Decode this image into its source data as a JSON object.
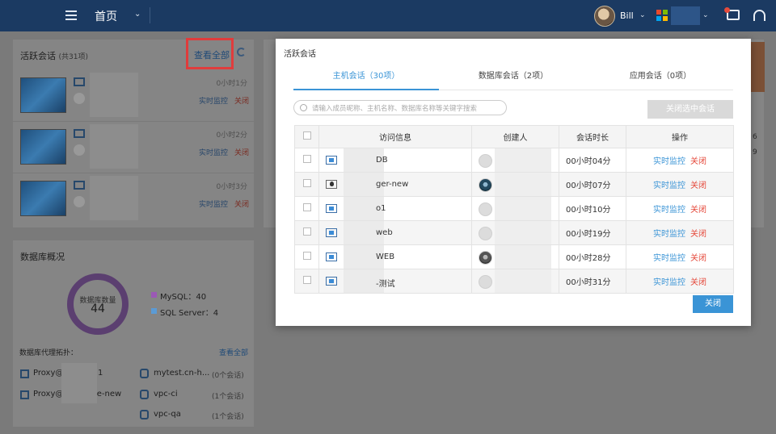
{
  "topbar": {
    "home_label": "首页",
    "user_name": "Bill",
    "colors": {
      "bar": "#1b3a62",
      "ms_red": "#e8492c",
      "ms_green": "#7fba00",
      "ms_blue": "#00a4ef",
      "ms_yellow": "#ffb900"
    }
  },
  "sessions_panel": {
    "title": "活跃会话",
    "count_text": "(共31项)",
    "view_all": "查看全部",
    "items": [
      {
        "duration": "0小时1分",
        "monitor": "实时监控",
        "close": "关闭"
      },
      {
        "duration": "0小时2分",
        "monitor": "实时监控",
        "close": "关闭"
      },
      {
        "duration": "0小时3分",
        "monitor": "实时监控",
        "close": "关闭"
      }
    ]
  },
  "db_panel": {
    "title": "数据库概况",
    "donut_label": "数据库数量",
    "donut_value": "44",
    "legend": [
      {
        "label": "MySQL：40",
        "color": "#9b59b6"
      },
      {
        "label": "SQL Server：4",
        "color": "#5b9bd5"
      }
    ],
    "proxy_title": "数据库代理拓扑：",
    "proxy_view_all": "查看全部",
    "proxies": [
      {
        "prefix": "Proxy@",
        "suffix": "1"
      },
      {
        "prefix": "Proxy@",
        "suffix": "je-new"
      }
    ],
    "nodes": [
      {
        "name": "mytest.cn-h...",
        "count": "(0个会话)"
      },
      {
        "name": "vpc-ci",
        "count": "(1个会话)"
      },
      {
        "name": "vpc-qa",
        "count": "(1个会话)"
      }
    ]
  },
  "right_panel": {
    "numbers": [
      "6",
      "9"
    ]
  },
  "modal": {
    "title": "活跃会话",
    "tabs": [
      {
        "label": "主机会话（30项）",
        "active": true
      },
      {
        "label": "数据库会话（2项）",
        "active": false
      },
      {
        "label": "应用会话（0项）",
        "active": false
      }
    ],
    "search_placeholder": "请输入成员昵称、主机名称、数据库名称等关键字搜索",
    "close_selected_label": "关闭选中会话",
    "table": {
      "headers": [
        "访问信息",
        "创建人",
        "会话时长",
        "操作"
      ],
      "rows": [
        {
          "os": "windows",
          "info": "DB",
          "avatar": "default",
          "duration": "00小时04分",
          "monitor": "实时监控",
          "close": "关闭"
        },
        {
          "os": "linux",
          "info": "ger-new",
          "avatar": "photo1",
          "duration": "00小时07分",
          "monitor": "实时监控",
          "close": "关闭"
        },
        {
          "os": "windows",
          "info": "o1",
          "avatar": "default",
          "duration": "00小时10分",
          "monitor": "实时监控",
          "close": "关闭"
        },
        {
          "os": "windows",
          "info": "web",
          "avatar": "default",
          "duration": "00小时19分",
          "monitor": "实时监控",
          "close": "关闭"
        },
        {
          "os": "windows",
          "info": "WEB",
          "avatar": "photo2",
          "duration": "00小时28分",
          "monitor": "实时监控",
          "close": "关闭"
        },
        {
          "os": "windows",
          "info": "-测试",
          "avatar": "default",
          "duration": "00小时31分",
          "monitor": "实时监控",
          "close": "关闭"
        }
      ]
    },
    "close_label": "关闭"
  }
}
